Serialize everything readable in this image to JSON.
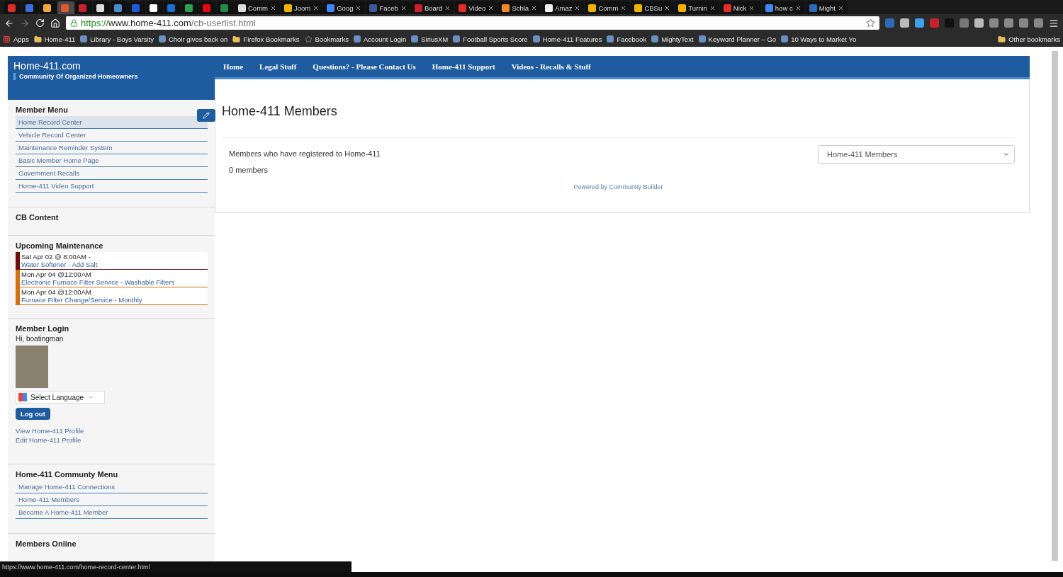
{
  "browser": {
    "tabs": [
      {
        "selected": false,
        "color": "#d93025"
      },
      {
        "selected": false,
        "color": "#3b6fd8"
      },
      {
        "selected": false,
        "color": "#f2a93b"
      },
      {
        "selected": true,
        "color": "#e0592a"
      },
      {
        "selected": false,
        "color": "#c8232c"
      },
      {
        "selected": false,
        "color": "#dddddd"
      },
      {
        "selected": false,
        "color": "#4a90c8"
      },
      {
        "selected": false,
        "color": "#1e5bd6"
      },
      {
        "selected": false,
        "color": "#ffffff"
      },
      {
        "selected": false,
        "color": "#1c6fd1"
      },
      {
        "selected": false,
        "color": "#2e9e4f"
      },
      {
        "selected": false,
        "color": "#e50914"
      },
      {
        "selected": false,
        "color": "#1f8a4c"
      },
      {
        "title": "Comm",
        "selected": false,
        "color": "#dddddd"
      },
      {
        "title": "Joom",
        "selected": false,
        "color": "#f0b400"
      },
      {
        "title": "Goog",
        "selected": false,
        "color": "#4285f4"
      },
      {
        "title": "Faceb",
        "selected": false,
        "color": "#3b5998"
      },
      {
        "title": "Board",
        "selected": false,
        "color": "#c8232c"
      },
      {
        "title": "Video",
        "selected": false,
        "color": "#e52d27"
      },
      {
        "title": "Schla",
        "selected": false,
        "color": "#f08a24"
      },
      {
        "title": "Amaz",
        "selected": false,
        "color": "#f2f2f2"
      },
      {
        "title": "Comm",
        "selected": false,
        "color": "#f0b400"
      },
      {
        "title": "CBSu",
        "selected": false,
        "color": "#f0b400"
      },
      {
        "title": "Turnin",
        "selected": false,
        "color": "#f0b400"
      },
      {
        "title": "Nick",
        "selected": false,
        "color": "#e52d27"
      },
      {
        "title": "how c",
        "selected": false,
        "color": "#4285f4"
      },
      {
        "title": "Might",
        "selected": false,
        "color": "#2c6bb3"
      }
    ],
    "address": {
      "scheme": "https://",
      "host": "www.home-411.com",
      "path": "/cb-userlist.html"
    },
    "bookmarks": [
      {
        "label": "Apps",
        "kind": "apps"
      },
      {
        "label": "Home-411",
        "kind": "folder"
      },
      {
        "label": "Library - Boys Varsity",
        "kind": "site"
      },
      {
        "label": "Choir gives back on",
        "kind": "site"
      },
      {
        "label": "Firefox Bookmarks",
        "kind": "folder"
      },
      {
        "label": "Bookmarks",
        "kind": "star"
      },
      {
        "label": "Account Login",
        "kind": "site"
      },
      {
        "label": "SiriusXM",
        "kind": "site"
      },
      {
        "label": "Football Sports Score",
        "kind": "site"
      },
      {
        "label": "Home-411 Features",
        "kind": "site"
      },
      {
        "label": "Facebook",
        "kind": "site"
      },
      {
        "label": "MightyText",
        "kind": "site"
      },
      {
        "label": "Keyword Planner – Go",
        "kind": "site"
      },
      {
        "label": "10 Ways to Market Yo",
        "kind": "site"
      }
    ],
    "other_bookmarks": "Other bookmarks"
  },
  "site": {
    "brand": "Home-411.com",
    "tagline": "Community Of Organized Homeowners",
    "nav": [
      "Home",
      "Legal Stuff",
      "Questions? - Please Contact Us",
      "Home-411 Support",
      "Videos - Recalls & Stuff"
    ],
    "sidebar": [
      {
        "kind": "menu",
        "title": "Member Menu",
        "items": [
          {
            "label": "Home Record Center",
            "selected": true
          },
          {
            "label": "Vehicle Record Center",
            "selected": false
          },
          {
            "label": "Maintenance Reminder System",
            "selected": false
          },
          {
            "label": "Basic Member Home Page",
            "selected": false
          },
          {
            "label": "Government Recalls",
            "selected": false
          },
          {
            "label": "Home-411 Video Support",
            "selected": false
          }
        ]
      },
      {
        "kind": "empty",
        "title": "CB Content"
      },
      {
        "kind": "events",
        "title": "Upcoming Maintenance",
        "events": [
          {
            "when": "Sat Apr 02 @ 8:00AM -",
            "task": "Water Softener - Add Salt",
            "color": "#6b0d0d"
          },
          {
            "when": "Mon Apr 04 @12:00AM",
            "task": "Electronic Furnace Filter Service - Washable Filters",
            "color": "#d0700e"
          },
          {
            "when": "Mon Apr 04 @12:00AM",
            "task": "Furnace Filter Change/Service - Monthly",
            "color": "#d0700e"
          }
        ]
      },
      {
        "kind": "login",
        "title": "Member Login",
        "greeting": "Hi, boatingman",
        "language": "Select Language",
        "logout": "Log out",
        "links": [
          "View Home-411 Profile",
          "Edit Home-411 Profile"
        ]
      },
      {
        "kind": "menu",
        "title": "Home-411 Communty Menu",
        "items": [
          {
            "label": "Manage Home-411 Connections",
            "selected": false
          },
          {
            "label": "Home-411 Members",
            "selected": false
          },
          {
            "label": "Become A Home-411 Member",
            "selected": false
          }
        ]
      },
      {
        "kind": "empty",
        "title": "Members Online"
      }
    ],
    "content": {
      "title": "Home-411 Members",
      "description": "Members who have registered to Home-411",
      "count": "0 members",
      "list_select": "Home-411 Members",
      "powered_by": "Powered by Community Builder"
    }
  },
  "status_bar": "https://www.home-411.com/home-record-center.html"
}
